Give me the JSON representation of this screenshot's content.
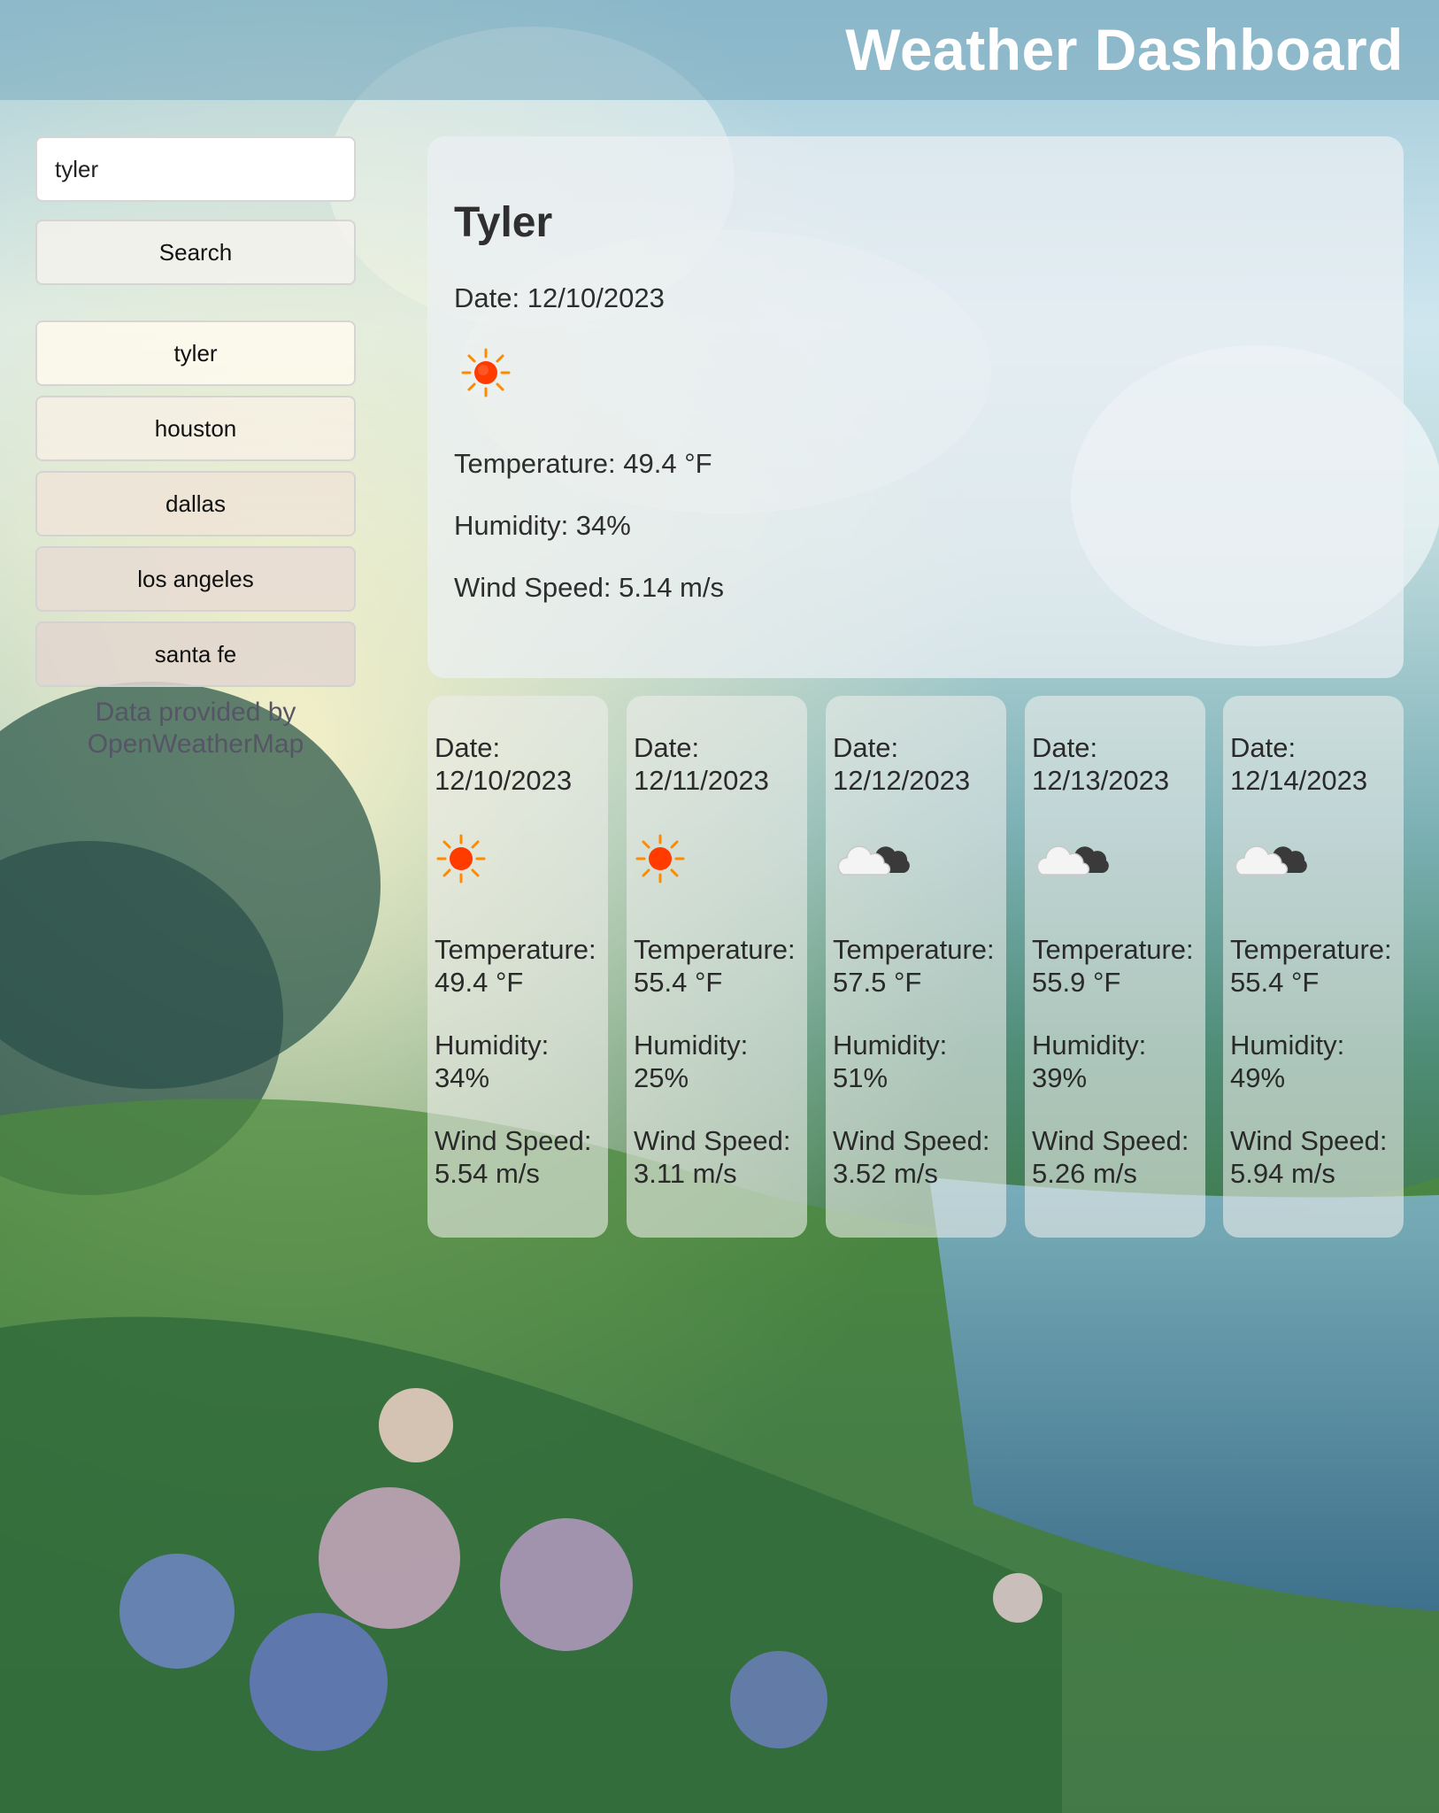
{
  "header": {
    "title": "Weather Dashboard"
  },
  "search": {
    "value": "tyler",
    "button_label": "Search"
  },
  "history": [
    {
      "label": "tyler"
    },
    {
      "label": "houston"
    },
    {
      "label": "dallas"
    },
    {
      "label": "los angeles"
    },
    {
      "label": "santa fe"
    }
  ],
  "credit": "Data provided by OpenWeatherMap",
  "current": {
    "city": "Tyler",
    "date": "Date: 12/10/2023",
    "icon": "sun-icon",
    "temperature": "Temperature: 49.4 °F",
    "humidity": "Humidity: 34%",
    "wind": "Wind Speed: 5.14 m/s"
  },
  "forecast": [
    {
      "date_label": "Date:",
      "date": "12/10/2023",
      "icon": "sun-icon",
      "temp_label": "Temperature:",
      "temp": "49.4 °F",
      "hum_label": "Humidity:",
      "hum": "34%",
      "wind_label": "Wind Speed:",
      "wind": "5.54 m/s"
    },
    {
      "date_label": "Date:",
      "date": "12/11/2023",
      "icon": "sun-icon",
      "temp_label": "Temperature:",
      "temp": "55.4 °F",
      "hum_label": "Humidity:",
      "hum": "25%",
      "wind_label": "Wind Speed:",
      "wind": "3.11 m/s"
    },
    {
      "date_label": "Date:",
      "date": "12/12/2023",
      "icon": "cloud-icon",
      "temp_label": "Temperature:",
      "temp": "57.5 °F",
      "hum_label": "Humidity:",
      "hum": "51%",
      "wind_label": "Wind Speed:",
      "wind": "3.52 m/s"
    },
    {
      "date_label": "Date:",
      "date": "12/13/2023",
      "icon": "cloud-icon",
      "temp_label": "Temperature:",
      "temp": "55.9 °F",
      "hum_label": "Humidity:",
      "hum": "39%",
      "wind_label": "Wind Speed:",
      "wind": "5.26 m/s"
    },
    {
      "date_label": "Date:",
      "date": "12/14/2023",
      "icon": "cloud-icon",
      "temp_label": "Temperature:",
      "temp": "55.4 °F",
      "hum_label": "Humidity:",
      "hum": "49%",
      "wind_label": "Wind Speed:",
      "wind": "5.94 m/s"
    }
  ],
  "colors": {
    "header_text": "#ffffff",
    "sun": "#ff3b00",
    "sun_ray": "#ff8a00"
  }
}
